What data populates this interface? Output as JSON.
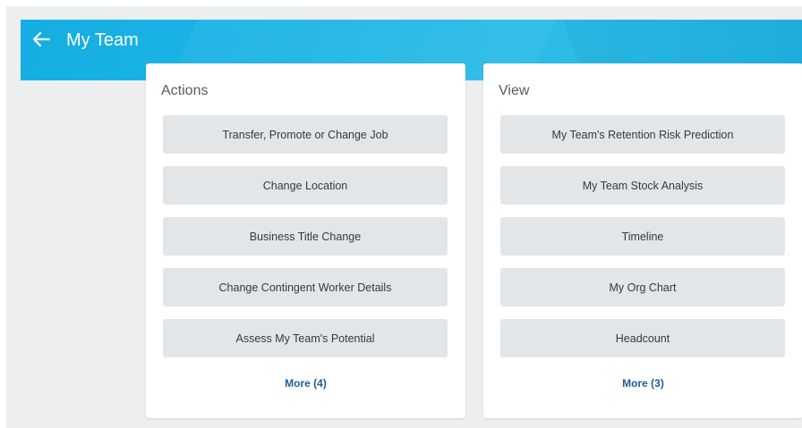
{
  "header": {
    "title": "My Team",
    "back_icon": "arrow-left-icon",
    "colors": {
      "banner": "#1fb6e5",
      "text": "#ffffff"
    }
  },
  "actions_card": {
    "title": "Actions",
    "items": [
      "Transfer, Promote or Change Job",
      "Change Location",
      "Business Title Change",
      "Change Contingent Worker Details",
      "Assess My Team's Potential"
    ],
    "more_label": "More (4)"
  },
  "view_card": {
    "title": "View",
    "items": [
      "My Team's Retention Risk Prediction",
      "My Team Stock Analysis",
      "Timeline",
      "My Org Chart",
      "Headcount"
    ],
    "more_label": "More (3)"
  },
  "colors": {
    "page_background": "#eceef0",
    "button_background": "#e3e6e8",
    "link": "#1d5e9a"
  }
}
